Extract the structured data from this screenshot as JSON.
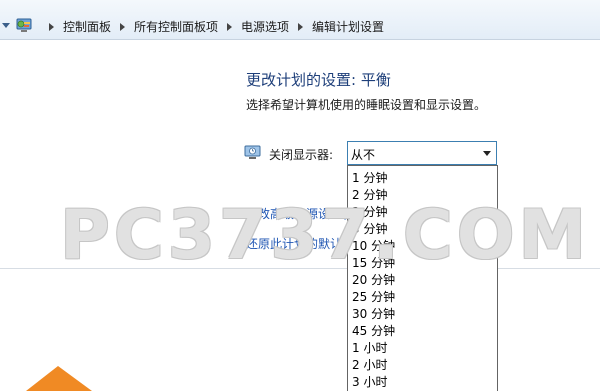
{
  "breadcrumb": [
    "控制面板",
    "所有控制面板项",
    "电源选项",
    "编辑计划设置"
  ],
  "page": {
    "title": "更改计划的设置: 平衡",
    "subtitle": "选择希望计算机使用的睡眠设置和显示设置。"
  },
  "display_setting": {
    "label": "关闭显示器:",
    "selected": "从不"
  },
  "dropdown_options": [
    "1 分钟",
    "2 分钟",
    "3 分钟",
    "5 分钟",
    "10 分钟",
    "15 分钟",
    "20 分钟",
    "25 分钟",
    "30 分钟",
    "45 分钟",
    "1 小时",
    "2 小时",
    "3 小时"
  ],
  "links": {
    "advanced": "更改高级电源设置(C)",
    "restore": "还原此计划的默认设置"
  },
  "watermark": "PC3737.COM",
  "colors": {
    "title_blue": "#1e3f7a",
    "link_blue": "#1f56b3",
    "select_border": "#3c7fb1"
  }
}
